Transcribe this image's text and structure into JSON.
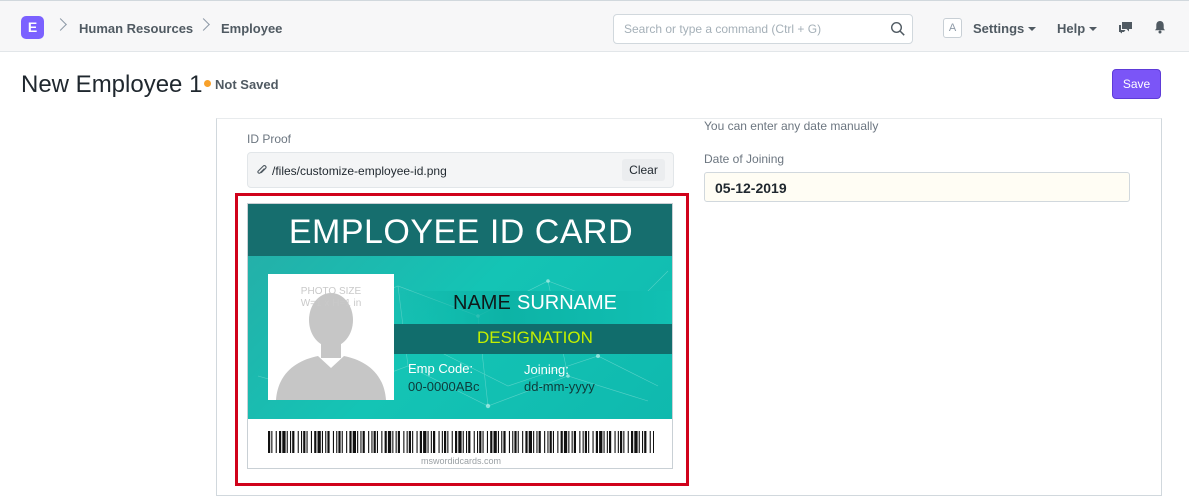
{
  "navbar": {
    "logo": "E",
    "breadcrumbs": [
      "Human Resources",
      "Employee"
    ],
    "search_placeholder": "Search or type a command (Ctrl + G)",
    "avatar": "A",
    "settings_label": "Settings",
    "help_label": "Help"
  },
  "page": {
    "title": "New Employee 1",
    "status": "Not Saved",
    "save_label": "Save"
  },
  "form": {
    "id_proof_label": "ID Proof",
    "id_proof_path": "/files/customize-employee-id.png",
    "clear_label": "Clear",
    "date_hint": "You can enter any date manually",
    "doj_label": "Date of Joining",
    "doj_value": "05-12-2019"
  },
  "id_card": {
    "title": "EMPLOYEE ID CARD",
    "photo_hint_line1": "PHOTO SIZE",
    "photo_hint_line2": "W=1 x H=1 in",
    "name_first": "NAME",
    "name_last": "SURNAME",
    "designation": "DESIGNATION",
    "emp_code_label": "Emp Code:",
    "emp_code_value": "00-0000ABc",
    "joining_label": "Joining:",
    "joining_value": "dd-mm-yyyy",
    "site": "mswordidcards.com"
  },
  "colors": {
    "brand": "#7b55f7",
    "highlight": "#d0021b",
    "status_dot": "#f8a12a",
    "card_dark": "#166e6e",
    "card_teal": "#14c4b5",
    "designation": "#c4f000"
  }
}
